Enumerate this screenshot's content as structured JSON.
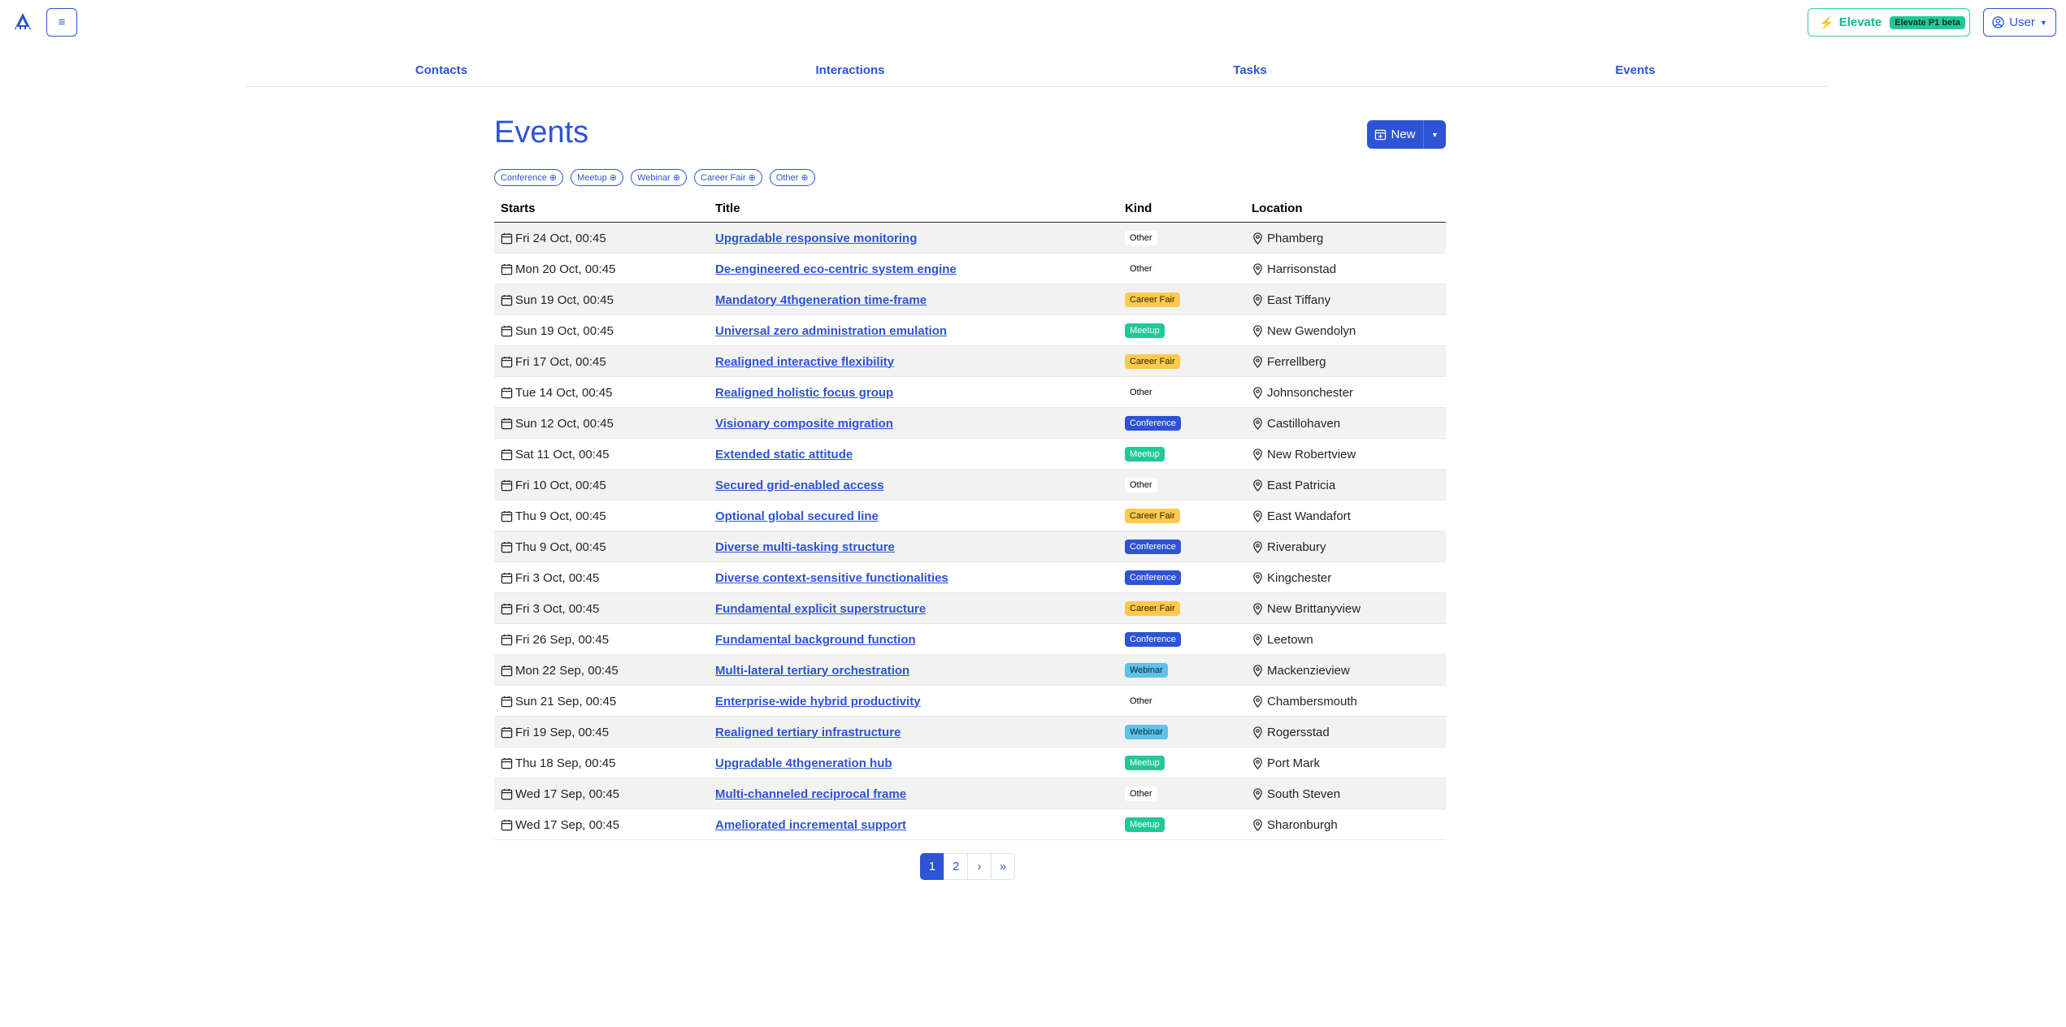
{
  "header": {
    "menu_glyph": "≡",
    "elevate": {
      "bolt": "⚡",
      "label": "Elevate",
      "badge": "Elevate P1 beta"
    },
    "user_label": "User",
    "caret": "▼"
  },
  "nav": [
    {
      "label": "Contacts"
    },
    {
      "label": "Interactions"
    },
    {
      "label": "Tasks"
    },
    {
      "label": "Events"
    }
  ],
  "page": {
    "title": "Events",
    "new_label": "New"
  },
  "filters": [
    {
      "label": "Conference"
    },
    {
      "label": "Meetup"
    },
    {
      "label": "Webinar"
    },
    {
      "label": "Career Fair"
    },
    {
      "label": "Other"
    }
  ],
  "table": {
    "headers": {
      "starts": "Starts",
      "title": "Title",
      "kind": "Kind",
      "location": "Location"
    },
    "rows": [
      {
        "starts": "Fri 24 Oct, 00:45",
        "title": "Upgradable responsive monitoring",
        "kind": "Other",
        "location": "Phamberg"
      },
      {
        "starts": "Mon 20 Oct, 00:45",
        "title": "De-engineered eco-centric system engine",
        "kind": "Other",
        "location": "Harrisonstad"
      },
      {
        "starts": "Sun 19 Oct, 00:45",
        "title": "Mandatory 4thgeneration time-frame",
        "kind": "Career Fair",
        "location": "East Tiffany"
      },
      {
        "starts": "Sun 19 Oct, 00:45",
        "title": "Universal zero administration emulation",
        "kind": "Meetup",
        "location": "New Gwendolyn"
      },
      {
        "starts": "Fri 17 Oct, 00:45",
        "title": "Realigned interactive flexibility",
        "kind": "Career Fair",
        "location": "Ferrellberg"
      },
      {
        "starts": "Tue 14 Oct, 00:45",
        "title": "Realigned holistic focus group",
        "kind": "Other",
        "location": "Johnsonchester"
      },
      {
        "starts": "Sun 12 Oct, 00:45",
        "title": "Visionary composite migration",
        "kind": "Conference",
        "location": "Castillohaven"
      },
      {
        "starts": "Sat 11 Oct, 00:45",
        "title": "Extended static attitude",
        "kind": "Meetup",
        "location": "New Robertview"
      },
      {
        "starts": "Fri 10 Oct, 00:45",
        "title": "Secured grid-enabled access",
        "kind": "Other",
        "location": "East Patricia"
      },
      {
        "starts": "Thu 9 Oct, 00:45",
        "title": "Optional global secured line",
        "kind": "Career Fair",
        "location": "East Wandafort"
      },
      {
        "starts": "Thu 9 Oct, 00:45",
        "title": "Diverse multi-tasking structure",
        "kind": "Conference",
        "location": "Riverabury"
      },
      {
        "starts": "Fri 3 Oct, 00:45",
        "title": "Diverse context-sensitive functionalities",
        "kind": "Conference",
        "location": "Kingchester"
      },
      {
        "starts": "Fri 3 Oct, 00:45",
        "title": "Fundamental explicit superstructure",
        "kind": "Career Fair",
        "location": "New Brittanyview"
      },
      {
        "starts": "Fri 26 Sep, 00:45",
        "title": "Fundamental background function",
        "kind": "Conference",
        "location": "Leetown"
      },
      {
        "starts": "Mon 22 Sep, 00:45",
        "title": "Multi-lateral tertiary orchestration",
        "kind": "Webinar",
        "location": "Mackenzieview"
      },
      {
        "starts": "Sun 21 Sep, 00:45",
        "title": "Enterprise-wide hybrid productivity",
        "kind": "Other",
        "location": "Chambersmouth"
      },
      {
        "starts": "Fri 19 Sep, 00:45",
        "title": "Realigned tertiary infrastructure",
        "kind": "Webinar",
        "location": "Rogersstad"
      },
      {
        "starts": "Thu 18 Sep, 00:45",
        "title": "Upgradable 4thgeneration hub",
        "kind": "Meetup",
        "location": "Port Mark"
      },
      {
        "starts": "Wed 17 Sep, 00:45",
        "title": "Multi-channeled reciprocal frame",
        "kind": "Other",
        "location": "South Steven"
      },
      {
        "starts": "Wed 17 Sep, 00:45",
        "title": "Ameliorated incremental support",
        "kind": "Meetup",
        "location": "Sharonburgh"
      }
    ]
  },
  "pagination": [
    {
      "label": "1",
      "active": true
    },
    {
      "label": "2",
      "active": false
    },
    {
      "label": "›",
      "active": false
    },
    {
      "label": "»",
      "active": false
    }
  ],
  "colors": {
    "primary": "#2e53d6",
    "meetup": "#20c997",
    "webinar": "#5ec2ea",
    "career_fair": "#ffc94d",
    "elevate_border": "#3ec9a7"
  }
}
